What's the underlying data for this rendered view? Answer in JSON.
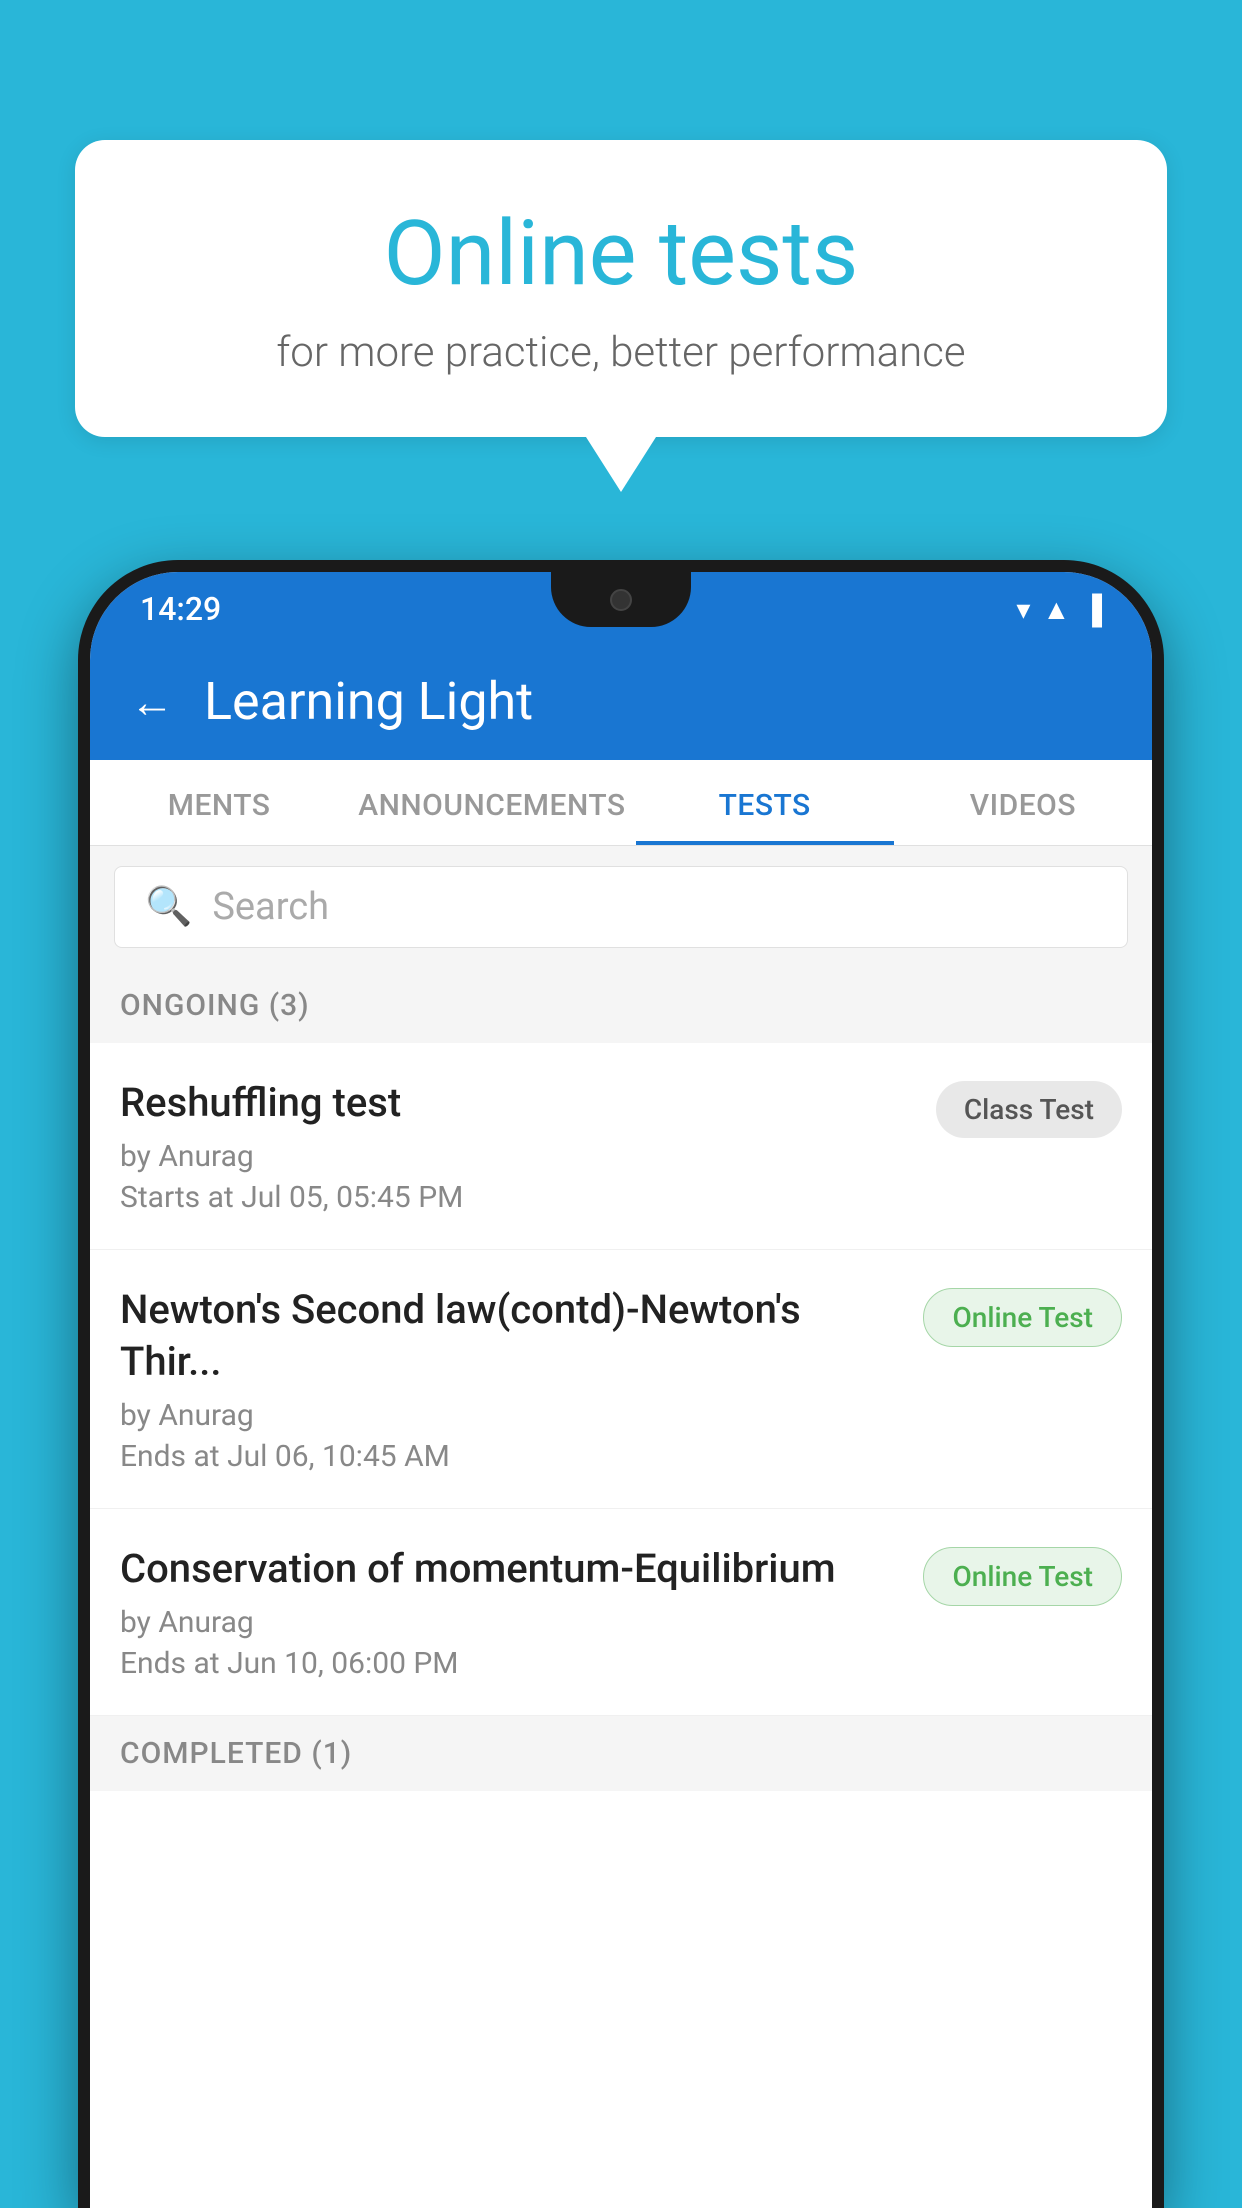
{
  "background_color": "#29b6d8",
  "bubble": {
    "title": "Online tests",
    "subtitle": "for more practice, better performance"
  },
  "phone": {
    "status_bar": {
      "time": "14:29",
      "icons": [
        "wifi",
        "signal",
        "battery"
      ]
    },
    "app_bar": {
      "back_label": "←",
      "title": "Learning Light"
    },
    "tabs": [
      {
        "label": "MENTS",
        "active": false
      },
      {
        "label": "ANNOUNCEMENTS",
        "active": false
      },
      {
        "label": "TESTS",
        "active": true
      },
      {
        "label": "VIDEOS",
        "active": false
      }
    ],
    "search": {
      "placeholder": "Search"
    },
    "ongoing_section": {
      "title": "ONGOING (3)",
      "tests": [
        {
          "name": "Reshuffling test",
          "author": "by Anurag",
          "time_label": "Starts at",
          "time": "Jul 05, 05:45 PM",
          "badge": "Class Test",
          "badge_type": "class"
        },
        {
          "name": "Newton's Second law(contd)-Newton's Thir...",
          "author": "by Anurag",
          "time_label": "Ends at",
          "time": "Jul 06, 10:45 AM",
          "badge": "Online Test",
          "badge_type": "online"
        },
        {
          "name": "Conservation of momentum-Equilibrium",
          "author": "by Anurag",
          "time_label": "Ends at",
          "time": "Jun 10, 06:00 PM",
          "badge": "Online Test",
          "badge_type": "online"
        }
      ]
    },
    "completed_section": {
      "title": "COMPLETED (1)"
    }
  }
}
